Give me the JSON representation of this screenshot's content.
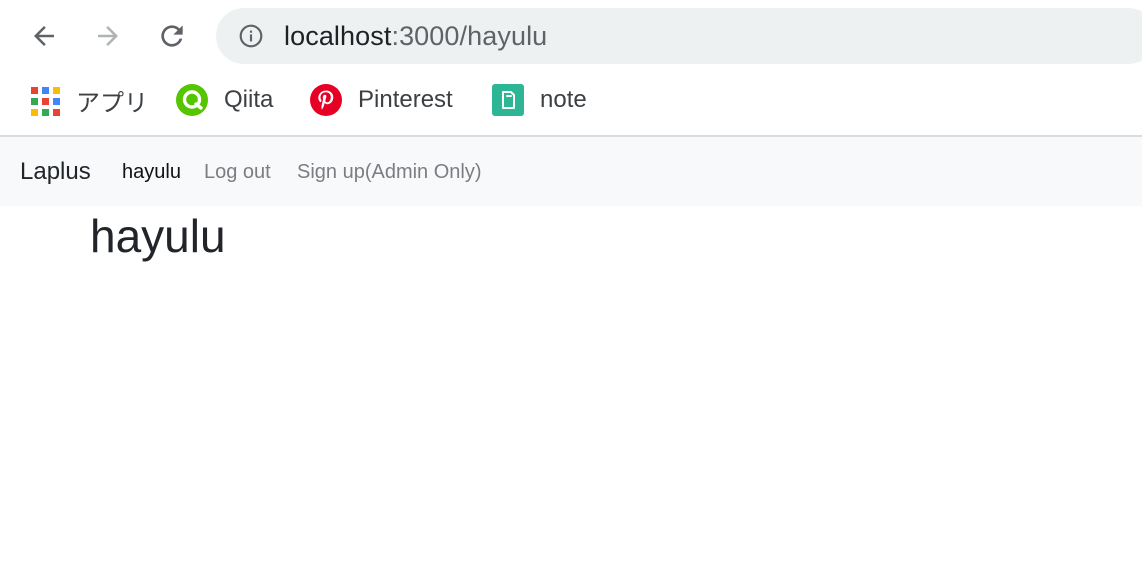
{
  "browser": {
    "url_host": "localhost",
    "url_rest": ":3000/hayulu",
    "back_icon": "arrow-left",
    "forward_icon": "arrow-right",
    "reload_icon": "reload",
    "info_icon": "info-circle"
  },
  "bookmarks": [
    {
      "label": "アプリ",
      "icon": "apps-grid"
    },
    {
      "label": "Qiita",
      "icon": "qiita",
      "color": "#55c500"
    },
    {
      "label": "Pinterest",
      "icon": "pinterest",
      "color": "#e60023"
    },
    {
      "label": "note",
      "icon": "note",
      "color": "#2cb696"
    }
  ],
  "navbar": {
    "brand": "Laplus",
    "links": [
      "hayulu",
      "Log out",
      "Sign up(Admin Only)"
    ]
  },
  "main": {
    "title": "hayulu"
  }
}
